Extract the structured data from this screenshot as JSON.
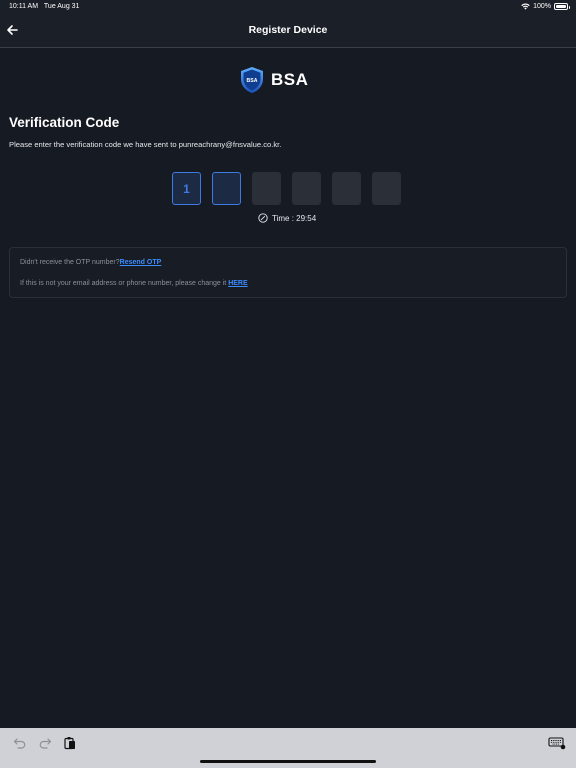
{
  "status_bar": {
    "time": "10:11 AM",
    "date": "Tue Aug 31",
    "battery": "100%"
  },
  "nav": {
    "title": "Register Device"
  },
  "logo": {
    "text": "BSA",
    "shield_text": "BSA"
  },
  "verification": {
    "heading": "Verification Code",
    "instruction": "Please enter the verification code we have sent to punreachrany@fnsvalue.co.kr.",
    "digits": [
      "1",
      "",
      "",
      "",
      "",
      ""
    ],
    "timer": "Time : 29:54"
  },
  "info": {
    "resend_prompt": "Didn't receive the OTP number?",
    "resend_link": "Resend OTP",
    "change_prompt": "If this is not your email address or phone number, please change it ",
    "change_link": "HERE"
  },
  "colors": {
    "accent": "#3d7be0",
    "link": "#3b8cff",
    "background": "#161a22"
  }
}
